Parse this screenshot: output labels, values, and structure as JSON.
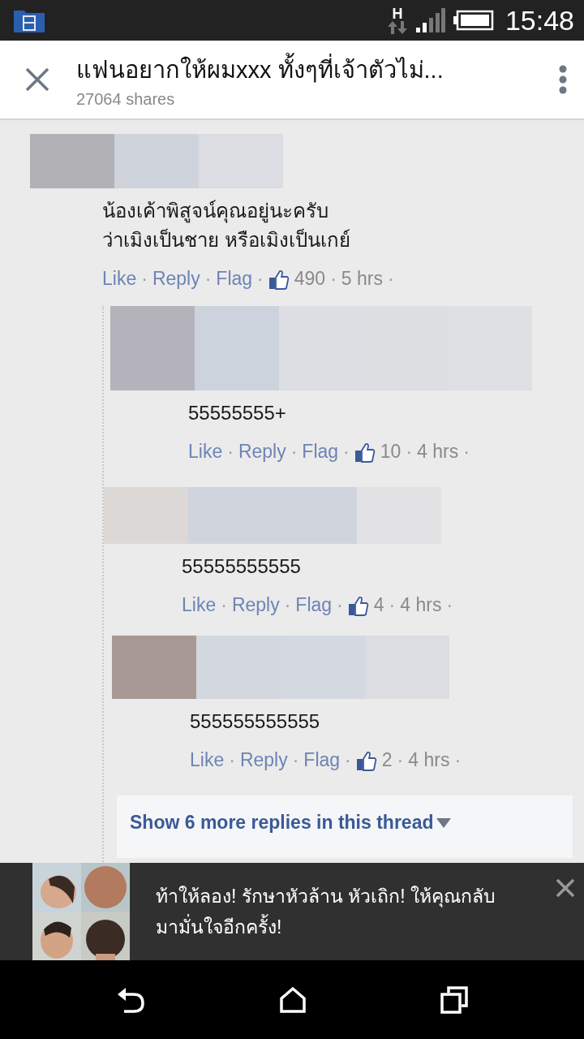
{
  "status_bar": {
    "time": "15:48",
    "network": "H"
  },
  "header": {
    "title": "แฟนอยากให้ผมxxx ทั้งๆที่เจ้าตัวไม่...",
    "subtitle": "27064 shares"
  },
  "comment": {
    "text": "น้องเค้าพิสูจน์คุณอยู่นะครับ\nว่าเมิงเป็นชาย หรือเมิงเป็นเกย์",
    "actions": [
      "Like",
      "Reply",
      "Flag"
    ],
    "likes": "490",
    "time": "5 hrs"
  },
  "replies": [
    {
      "text": "55555555+",
      "actions": [
        "Like",
        "Reply",
        "Flag"
      ],
      "likes": "10",
      "time": "4 hrs"
    },
    {
      "text": "55555555555",
      "actions": [
        "Like",
        "Reply",
        "Flag"
      ],
      "likes": "4",
      "time": "4 hrs"
    },
    {
      "text": "555555555555",
      "actions": [
        "Like",
        "Reply",
        "Flag"
      ],
      "likes": "2",
      "time": "4 hrs"
    }
  ],
  "show_more": "Show 6 more replies in this thread",
  "separator": "·",
  "ad": {
    "kind": "picture",
    "text": "ท้าให้ลอง! รักษาหัวล้าน หัวเถิก! ให้คุณกลับมามั่นใจอีกครั้ง!"
  }
}
